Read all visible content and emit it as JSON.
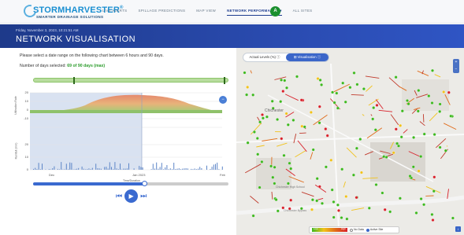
{
  "header": {
    "brand": "STORMHARVESTER",
    "trademark": "®",
    "tagline": "SMARTER DRAINAGE SOLUTIONS",
    "nav": [
      "LIVE ALERTS",
      "SPILLAGE PREDICTIONS",
      "MAP VIEW",
      "NETWORK PERFORMANCE ▾",
      "ALL SITES"
    ],
    "active_nav": "NETWORK PERFORMANCE ▾",
    "avatar": "A",
    "colors": {
      "brand": "#1a8fd1",
      "accent": "#1d3c8f",
      "avatar": "#1a8f2e"
    }
  },
  "banner": {
    "date": "Friday, November 3, 2023, 10:21:51 AM",
    "title": "NETWORK VISUALISATION"
  },
  "left": {
    "instruction": "Please select a date range on the following chart between 6 hours and 90 days.",
    "days_label": "Number of days selected:",
    "days_value": "69 of 90 days (max)",
    "range_fraction": [
      0.2,
      0.97
    ],
    "chart": {
      "upper_ylabel": "Utilisation Rate",
      "lower_ylabel": "Rainfall (mm)",
      "xlabel": "Time/Duration",
      "upper_ticks": [
        "20",
        "10",
        "0",
        "-10"
      ],
      "lower_ticks": [
        "20",
        "10",
        "0"
      ],
      "x_ticks": [
        "Dec",
        "Jan 2023",
        "Feb"
      ],
      "zoom_icon": "zoom-out-icon"
    },
    "playback": {
      "progress_fraction": 0.57
    },
    "controls": {
      "prev_icon": "skip-back-icon",
      "play_icon": "play-icon",
      "next_icon": "skip-forward-icon",
      "prev_glyph": "⏮",
      "play_glyph": "▶",
      "next_glyph": "⏭"
    }
  },
  "map": {
    "toggle": [
      "Actual Levels (%)  ⓘ",
      "⊞ Visualisation  ⓘ"
    ],
    "active_toggle": 1,
    "zoom": [
      "+",
      "−"
    ],
    "place_labels": [
      "Chichester",
      "Chichester High School",
      "Chichester Bypass"
    ],
    "legend": {
      "low": "Low",
      "high": "High",
      "no_data": "No Data",
      "active": "Active Site"
    },
    "colors": {
      "good": "#3db81e",
      "warn": "#f1c21b",
      "bad": "#d8202a"
    }
  }
}
